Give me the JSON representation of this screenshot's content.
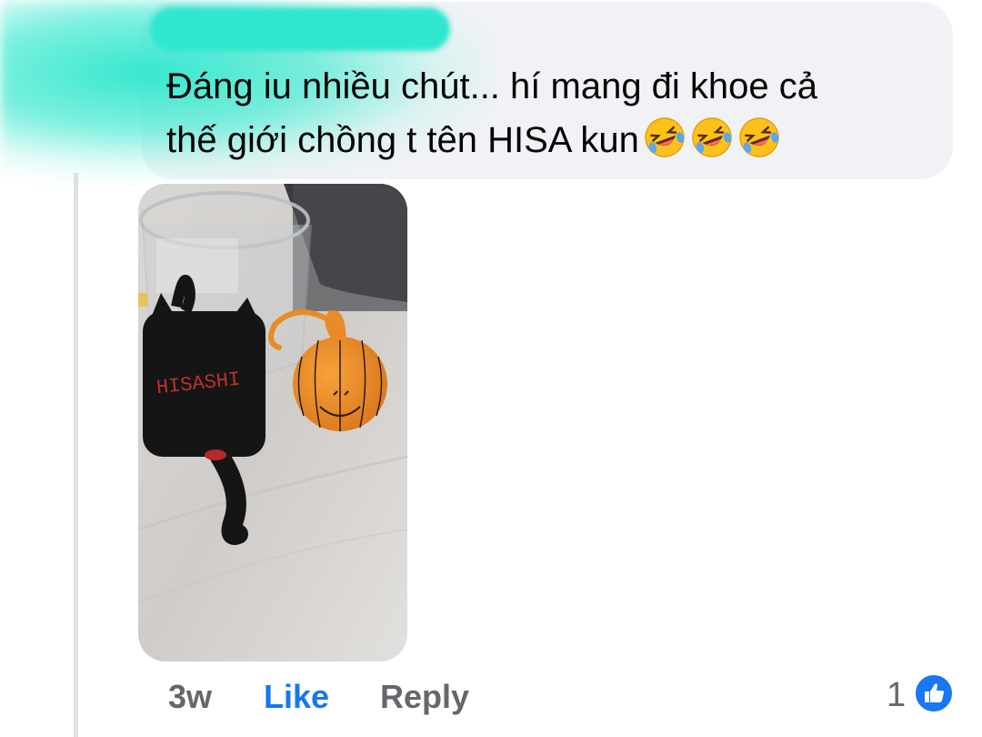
{
  "comment": {
    "text_line1": "Đáng iu nhiều chút... hí mang đi khoe cả",
    "text_line2": "thế giới chồng t tên HISA kun",
    "emoji": [
      "rolling-on-floor-laughing",
      "rolling-on-floor-laughing",
      "rolling-on-floor-laughing"
    ]
  },
  "photo": {
    "label_text": "HISASHI"
  },
  "actions": {
    "time": "3w",
    "like_label": "Like",
    "reply_label": "Reply"
  },
  "reactions": {
    "count": "1",
    "icon": "like-thumb-icon",
    "color": "#1877f2"
  },
  "colors": {
    "bubble": "#f0f2f5",
    "link_blue": "#1877f2",
    "muted": "#65676b",
    "redaction": "#2fe6cf"
  }
}
